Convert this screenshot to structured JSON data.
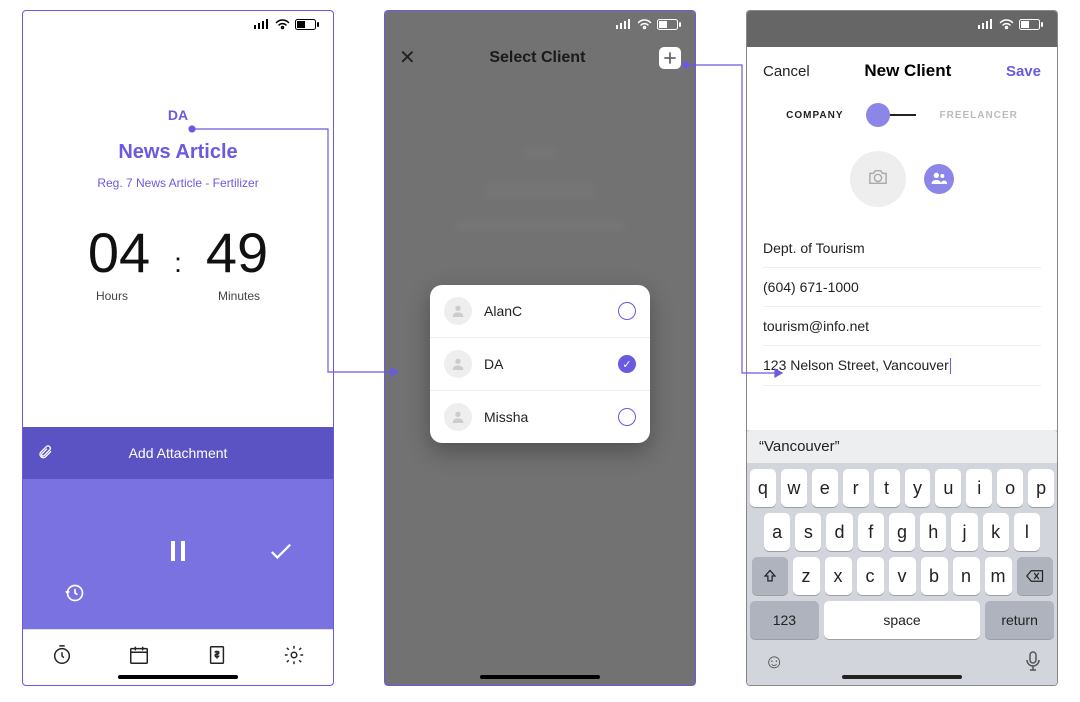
{
  "screen1": {
    "client": "DA",
    "project": "News Article",
    "task": "Reg. 7 News Article - Fertilizer",
    "hours": "04",
    "minutes": "49",
    "hours_label": "Hours",
    "minutes_label": "Minutes",
    "attach_label": "Add Attachment"
  },
  "screen2": {
    "title": "Select Client",
    "clients": [
      {
        "name": "AlanC",
        "selected": false
      },
      {
        "name": "DA",
        "selected": true
      },
      {
        "name": "Missha",
        "selected": false
      }
    ]
  },
  "screen3": {
    "cancel": "Cancel",
    "title": "New Client",
    "save": "Save",
    "toggle_left": "COMPANY",
    "toggle_right": "FREELANCER",
    "field_company": "Dept. of Tourism",
    "field_phone": "(604) 671-1000",
    "field_email": "tourism@info.net",
    "field_address": "123 Nelson Street, Vancouver",
    "suggestion": "“Vancouver”",
    "keys_r1": [
      "q",
      "w",
      "e",
      "r",
      "t",
      "y",
      "u",
      "i",
      "o",
      "p"
    ],
    "keys_r2": [
      "a",
      "s",
      "d",
      "f",
      "g",
      "h",
      "j",
      "k",
      "l"
    ],
    "keys_r3": [
      "z",
      "x",
      "c",
      "v",
      "b",
      "n",
      "m"
    ],
    "key_num": "123",
    "key_space": "space",
    "key_return": "return"
  }
}
